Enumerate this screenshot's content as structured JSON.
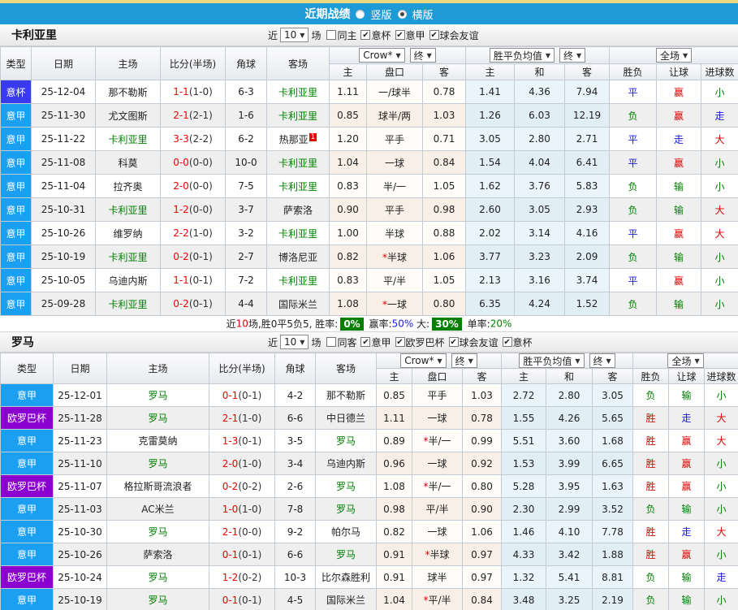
{
  "topbar": {
    "title": "近期战绩",
    "layout_options": [
      {
        "label": "竖版",
        "selected": false
      },
      {
        "label": "横版",
        "selected": true
      }
    ]
  },
  "table_header": {
    "type": "类型",
    "date": "日期",
    "home": "主场",
    "score": "比分(半场)",
    "corner": "角球",
    "away": "客场",
    "odds_source_dd": "Crow*",
    "odds_final_dd": "终",
    "mean_dd": "胜平负均值",
    "mean_final_dd": "终",
    "scope_dd": "全场",
    "sub": {
      "h_home": "主",
      "h_line": "盘口",
      "h_away": "客",
      "m_home": "主",
      "m_draw": "和",
      "m_away": "客",
      "wdl": "胜负",
      "handicap_res": "让球",
      "goals_res": "进球数"
    }
  },
  "colors": {
    "topbar_blue": "#1E9AD7",
    "top_strip_yellow": "#ECD97E",
    "league_yijia_blue": "#1B9FF0",
    "league_yibei_indigo": "#3A3AEF",
    "league_europa_purple": "#8A00CE",
    "win_red": "#E00000",
    "draw_blue": "#1616DD",
    "lose_green": "#008000",
    "featured_team_green": "#008000",
    "score_red": "#F00000",
    "badge_green": "#008000"
  },
  "sections": [
    {
      "team": "卡利亚里",
      "filters": {
        "prefix": "近",
        "count": "10",
        "suffix": "场",
        "checkboxes": [
          {
            "label": "同主",
            "checked": false
          },
          {
            "label": "意杯",
            "checked": true
          },
          {
            "label": "意甲",
            "checked": true
          },
          {
            "label": "球会友谊",
            "checked": true
          }
        ]
      },
      "rows": [
        {
          "league": "意杯",
          "date": "25-12-04",
          "home": "那不勒斯",
          "home_featured": false,
          "score": "1-1",
          "half": "(1-0)",
          "corner": "6-3",
          "away": "卡利亚里",
          "away_featured": true,
          "away_badge": "",
          "h_home": "1.11",
          "h_line": "一/球半",
          "h_away": "0.78",
          "m_home": "1.41",
          "m_draw": "4.36",
          "m_away": "7.94",
          "wdl": "平",
          "wdl_color": "blue",
          "let": "赢",
          "let_color": "red",
          "goal": "小",
          "goal_color": "green"
        },
        {
          "league": "意甲",
          "date": "25-11-30",
          "home": "尤文图斯",
          "home_featured": false,
          "score": "2-1",
          "half": "(2-1)",
          "corner": "1-6",
          "away": "卡利亚里",
          "away_featured": true,
          "away_badge": "",
          "h_home": "0.85",
          "h_line": "球半/两",
          "h_away": "1.03",
          "m_home": "1.26",
          "m_draw": "6.03",
          "m_away": "12.19",
          "wdl": "负",
          "wdl_color": "green",
          "let": "赢",
          "let_color": "red",
          "goal": "走",
          "goal_color": "blue"
        },
        {
          "league": "意甲",
          "date": "25-11-22",
          "home": "卡利亚里",
          "home_featured": true,
          "score": "3-3",
          "half": "(2-2)",
          "corner": "6-2",
          "away": "热那亚",
          "away_featured": false,
          "away_badge": "1",
          "h_home": "1.20",
          "h_line": "平手",
          "h_away": "0.71",
          "m_home": "3.05",
          "m_draw": "2.80",
          "m_away": "2.71",
          "wdl": "平",
          "wdl_color": "blue",
          "let": "走",
          "let_color": "blue",
          "goal": "大",
          "goal_color": "red"
        },
        {
          "league": "意甲",
          "date": "25-11-08",
          "home": "科莫",
          "home_featured": false,
          "score": "0-0",
          "half": "(0-0)",
          "corner": "10-0",
          "away": "卡利亚里",
          "away_featured": true,
          "away_badge": "",
          "h_home": "1.04",
          "h_line": "一球",
          "h_away": "0.84",
          "m_home": "1.54",
          "m_draw": "4.04",
          "m_away": "6.41",
          "wdl": "平",
          "wdl_color": "blue",
          "let": "赢",
          "let_color": "red",
          "goal": "小",
          "goal_color": "green"
        },
        {
          "league": "意甲",
          "date": "25-11-04",
          "home": "拉齐奥",
          "home_featured": false,
          "score": "2-0",
          "half": "(0-0)",
          "corner": "7-5",
          "away": "卡利亚里",
          "away_featured": true,
          "away_badge": "",
          "h_home": "0.83",
          "h_line": "半/一",
          "h_away": "1.05",
          "m_home": "1.62",
          "m_draw": "3.76",
          "m_away": "5.83",
          "wdl": "负",
          "wdl_color": "green",
          "let": "输",
          "let_color": "green",
          "goal": "小",
          "goal_color": "green"
        },
        {
          "league": "意甲",
          "date": "25-10-31",
          "home": "卡利亚里",
          "home_featured": true,
          "score": "1-2",
          "half": "(0-0)",
          "corner": "3-7",
          "away": "萨索洛",
          "away_featured": false,
          "away_badge": "",
          "h_home": "0.90",
          "h_line": "平手",
          "h_away": "0.98",
          "m_home": "2.60",
          "m_draw": "3.05",
          "m_away": "2.93",
          "wdl": "负",
          "wdl_color": "green",
          "let": "输",
          "let_color": "green",
          "goal": "大",
          "goal_color": "red"
        },
        {
          "league": "意甲",
          "date": "25-10-26",
          "home": "维罗纳",
          "home_featured": false,
          "score": "2-2",
          "half": "(1-0)",
          "corner": "3-2",
          "away": "卡利亚里",
          "away_featured": true,
          "away_badge": "",
          "h_home": "1.00",
          "h_line": "半球",
          "h_away": "0.88",
          "m_home": "2.02",
          "m_draw": "3.14",
          "m_away": "4.16",
          "wdl": "平",
          "wdl_color": "blue",
          "let": "赢",
          "let_color": "red",
          "goal": "大",
          "goal_color": "red"
        },
        {
          "league": "意甲",
          "date": "25-10-19",
          "home": "卡利亚里",
          "home_featured": true,
          "score": "0-2",
          "half": "(0-1)",
          "corner": "2-7",
          "away": "博洛尼亚",
          "away_featured": false,
          "away_badge": "",
          "h_home": "0.82",
          "h_line": "*半球",
          "h_away": "1.06",
          "m_home": "3.77",
          "m_draw": "3.23",
          "m_away": "2.09",
          "wdl": "负",
          "wdl_color": "green",
          "let": "输",
          "let_color": "green",
          "goal": "小",
          "goal_color": "green"
        },
        {
          "league": "意甲",
          "date": "25-10-05",
          "home": "乌迪内斯",
          "home_featured": false,
          "score": "1-1",
          "half": "(0-1)",
          "corner": "7-2",
          "away": "卡利亚里",
          "away_featured": true,
          "away_badge": "",
          "h_home": "0.83",
          "h_line": "平/半",
          "h_away": "1.05",
          "m_home": "2.13",
          "m_draw": "3.16",
          "m_away": "3.74",
          "wdl": "平",
          "wdl_color": "blue",
          "let": "赢",
          "let_color": "red",
          "goal": "小",
          "goal_color": "green"
        },
        {
          "league": "意甲",
          "date": "25-09-28",
          "home": "卡利亚里",
          "home_featured": true,
          "score": "0-2",
          "half": "(0-1)",
          "corner": "4-4",
          "away": "国际米兰",
          "away_featured": false,
          "away_badge": "",
          "h_home": "1.08",
          "h_line": "*一球",
          "h_away": "0.80",
          "m_home": "6.35",
          "m_draw": "4.24",
          "m_away": "1.52",
          "wdl": "负",
          "wdl_color": "green",
          "let": "输",
          "let_color": "green",
          "goal": "小",
          "goal_color": "green"
        }
      ],
      "summary": {
        "segments": [
          {
            "text": "近",
            "style": "black"
          },
          {
            "text": "10",
            "style": "red"
          },
          {
            "text": "场,胜0平5负5, 胜率:",
            "style": "black"
          },
          {
            "text": "0%",
            "style": "badge"
          },
          {
            "text": " 赢率:",
            "style": "black"
          },
          {
            "text": "50%",
            "style": "blue"
          },
          {
            "text": " 大:",
            "style": "black"
          },
          {
            "text": "30%",
            "style": "badge"
          },
          {
            "text": " 单率:",
            "style": "black"
          },
          {
            "text": "20%",
            "style": "green"
          }
        ]
      }
    },
    {
      "team": "罗马",
      "filters": {
        "prefix": "近",
        "count": "10",
        "suffix": "场",
        "checkboxes": [
          {
            "label": "同客",
            "checked": false
          },
          {
            "label": "意甲",
            "checked": true
          },
          {
            "label": "欧罗巴杯",
            "checked": true
          },
          {
            "label": "球会友谊",
            "checked": true
          },
          {
            "label": "意杯",
            "checked": true
          }
        ]
      },
      "rows": [
        {
          "league": "意甲",
          "date": "25-12-01",
          "home": "罗马",
          "home_featured": true,
          "score": "0-1",
          "half": "(0-1)",
          "corner": "4-2",
          "away": "那不勒斯",
          "away_featured": false,
          "away_badge": "",
          "h_home": "0.85",
          "h_line": "平手",
          "h_away": "1.03",
          "m_home": "2.72",
          "m_draw": "2.80",
          "m_away": "3.05",
          "wdl": "负",
          "wdl_color": "green",
          "let": "输",
          "let_color": "green",
          "goal": "小",
          "goal_color": "green"
        },
        {
          "league": "欧罗巴杯",
          "date": "25-11-28",
          "home": "罗马",
          "home_featured": true,
          "score": "2-1",
          "half": "(1-0)",
          "corner": "6-6",
          "away": "中日德兰",
          "away_featured": false,
          "away_badge": "",
          "h_home": "1.11",
          "h_line": "一球",
          "h_away": "0.78",
          "m_home": "1.55",
          "m_draw": "4.26",
          "m_away": "5.65",
          "wdl": "胜",
          "wdl_color": "red",
          "let": "走",
          "let_color": "blue",
          "goal": "大",
          "goal_color": "red"
        },
        {
          "league": "意甲",
          "date": "25-11-23",
          "home": "克雷莫纳",
          "home_featured": false,
          "score": "1-3",
          "half": "(0-1)",
          "corner": "3-5",
          "away": "罗马",
          "away_featured": true,
          "away_badge": "",
          "h_home": "0.89",
          "h_line": "*半/一",
          "h_away": "0.99",
          "m_home": "5.51",
          "m_draw": "3.60",
          "m_away": "1.68",
          "wdl": "胜",
          "wdl_color": "red",
          "let": "赢",
          "let_color": "red",
          "goal": "大",
          "goal_color": "red"
        },
        {
          "league": "意甲",
          "date": "25-11-10",
          "home": "罗马",
          "home_featured": true,
          "score": "2-0",
          "half": "(1-0)",
          "corner": "3-4",
          "away": "乌迪内斯",
          "away_featured": false,
          "away_badge": "",
          "h_home": "0.96",
          "h_line": "一球",
          "h_away": "0.92",
          "m_home": "1.53",
          "m_draw": "3.99",
          "m_away": "6.65",
          "wdl": "胜",
          "wdl_color": "red",
          "let": "赢",
          "let_color": "red",
          "goal": "小",
          "goal_color": "green"
        },
        {
          "league": "欧罗巴杯",
          "date": "25-11-07",
          "home": "格拉斯哥流浪者",
          "home_featured": false,
          "score": "0-2",
          "half": "(0-2)",
          "corner": "2-6",
          "away": "罗马",
          "away_featured": true,
          "away_badge": "",
          "h_home": "1.08",
          "h_line": "*半/一",
          "h_away": "0.80",
          "m_home": "5.28",
          "m_draw": "3.95",
          "m_away": "1.63",
          "wdl": "胜",
          "wdl_color": "red",
          "let": "赢",
          "let_color": "red",
          "goal": "小",
          "goal_color": "green"
        },
        {
          "league": "意甲",
          "date": "25-11-03",
          "home": "AC米兰",
          "home_featured": false,
          "score": "1-0",
          "half": "(1-0)",
          "corner": "7-8",
          "away": "罗马",
          "away_featured": true,
          "away_badge": "",
          "h_home": "0.98",
          "h_line": "平/半",
          "h_away": "0.90",
          "m_home": "2.30",
          "m_draw": "2.99",
          "m_away": "3.52",
          "wdl": "负",
          "wdl_color": "green",
          "let": "输",
          "let_color": "green",
          "goal": "小",
          "goal_color": "green"
        },
        {
          "league": "意甲",
          "date": "25-10-30",
          "home": "罗马",
          "home_featured": true,
          "score": "2-1",
          "half": "(0-0)",
          "corner": "9-2",
          "away": "帕尔马",
          "away_featured": false,
          "away_badge": "",
          "h_home": "0.82",
          "h_line": "一球",
          "h_away": "1.06",
          "m_home": "1.46",
          "m_draw": "4.10",
          "m_away": "7.78",
          "wdl": "胜",
          "wdl_color": "red",
          "let": "走",
          "let_color": "blue",
          "goal": "大",
          "goal_color": "red"
        },
        {
          "league": "意甲",
          "date": "25-10-26",
          "home": "萨索洛",
          "home_featured": false,
          "score": "0-1",
          "half": "(0-1)",
          "corner": "6-6",
          "away": "罗马",
          "away_featured": true,
          "away_badge": "",
          "h_home": "0.91",
          "h_line": "*半球",
          "h_away": "0.97",
          "m_home": "4.33",
          "m_draw": "3.42",
          "m_away": "1.88",
          "wdl": "胜",
          "wdl_color": "red",
          "let": "赢",
          "let_color": "red",
          "goal": "小",
          "goal_color": "green"
        },
        {
          "league": "欧罗巴杯",
          "date": "25-10-24",
          "home": "罗马",
          "home_featured": true,
          "score": "1-2",
          "half": "(0-2)",
          "corner": "10-3",
          "away": "比尔森胜利",
          "away_featured": false,
          "away_badge": "",
          "h_home": "0.91",
          "h_line": "球半",
          "h_away": "0.97",
          "m_home": "1.32",
          "m_draw": "5.41",
          "m_away": "8.81",
          "wdl": "负",
          "wdl_color": "green",
          "let": "输",
          "let_color": "green",
          "goal": "走",
          "goal_color": "blue"
        },
        {
          "league": "意甲",
          "date": "25-10-19",
          "home": "罗马",
          "home_featured": true,
          "score": "0-1",
          "half": "(0-1)",
          "corner": "4-5",
          "away": "国际米兰",
          "away_featured": false,
          "away_badge": "",
          "h_home": "1.04",
          "h_line": "*平/半",
          "h_away": "0.84",
          "m_home": "3.48",
          "m_draw": "3.25",
          "m_away": "2.19",
          "wdl": "负",
          "wdl_color": "green",
          "let": "输",
          "let_color": "green",
          "goal": "小",
          "goal_color": "green"
        }
      ],
      "summary": null
    }
  ]
}
